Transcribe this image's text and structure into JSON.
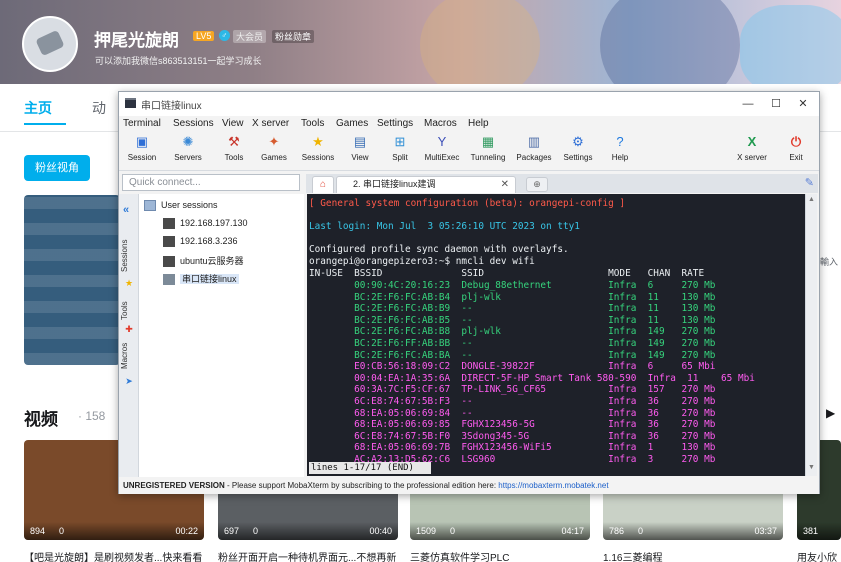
{
  "profile": {
    "username": "押尾光旋朗",
    "level": "LV5",
    "gender_symbol": "♂",
    "vip_badge": "大会员",
    "medal_badge": "粉丝勋章",
    "signature": "可以添加我微信s863513151一起学习成长",
    "nav_home": "主页",
    "nav_dynamic": "动",
    "fans_view_button": "粉丝视角",
    "right_cut_text": "輸入",
    "videos_title": "视频",
    "videos_count": "· 158",
    "next_arrow": "▶"
  },
  "videos": [
    {
      "views": "894",
      "danmaku": "0",
      "duration": "00:22",
      "title": "【吧是光旋朗】是刷视频发者...快来看看",
      "color": "#7a4a2a"
    },
    {
      "views": "697",
      "danmaku": "0",
      "duration": "00:40",
      "title": "粉丝开面开启一种待机界面元...不想再新",
      "color": "#5b5f63"
    },
    {
      "views": "1509",
      "danmaku": "0",
      "duration": "04:17",
      "title": "三菱仿真软件学习PLC",
      "color": "#b8c4b4"
    },
    {
      "views": "786",
      "danmaku": "0",
      "duration": "03:37",
      "title": "1.16三菱编程",
      "color": "#c9d1c6"
    },
    {
      "views": "381",
      "danmaku": "",
      "duration": "",
      "title": "用友小欣",
      "color": "#2d3a2c"
    }
  ],
  "window": {
    "title": "串口链接linux",
    "minimize": "—",
    "maximize": "☐",
    "close": "✕"
  },
  "menu": [
    "Terminal",
    "Sessions",
    "View",
    "X server",
    "Tools",
    "Games",
    "Settings",
    "Macros",
    "Help"
  ],
  "toolbar": [
    {
      "label": "Session",
      "icon": "session-icon",
      "glyph": "▣",
      "color": "#2f6fd6"
    },
    {
      "label": "Servers",
      "icon": "servers-icon",
      "glyph": "✺",
      "color": "#3a89d6"
    },
    {
      "label": "Tools",
      "icon": "tools-icon",
      "glyph": "⚒",
      "color": "#c8342a"
    },
    {
      "label": "Games",
      "icon": "games-icon",
      "glyph": "✦",
      "color": "#d65b2f"
    },
    {
      "label": "Sessions",
      "icon": "star-icon",
      "glyph": "★",
      "color": "#f0b400"
    },
    {
      "label": "View",
      "icon": "view-icon",
      "glyph": "▤",
      "color": "#3a6fb5"
    },
    {
      "label": "Split",
      "icon": "split-icon",
      "glyph": "⊞",
      "color": "#2f8fd6"
    },
    {
      "label": "MultiExec",
      "icon": "multiexec-icon",
      "glyph": "Y",
      "color": "#3c4fb8"
    },
    {
      "label": "Tunneling",
      "icon": "tunneling-icon",
      "glyph": "▦",
      "color": "#2f9a5f"
    },
    {
      "label": "Packages",
      "icon": "packages-icon",
      "glyph": "▥",
      "color": "#4f6ea8"
    },
    {
      "label": "Settings",
      "icon": "settings-icon",
      "glyph": "⚙",
      "color": "#2f6fd6"
    },
    {
      "label": "Help",
      "icon": "help-icon",
      "glyph": "?",
      "color": "#1e7ae0"
    }
  ],
  "toolbar_right": [
    {
      "label": "X server",
      "icon": "xserver-icon",
      "glyph": "X",
      "color": "#1f9a4f"
    },
    {
      "label": "Exit",
      "icon": "exit-icon",
      "glyph": "⏻",
      "color": "#e13a2b"
    }
  ],
  "quick_connect_placeholder": "Quick connect...",
  "tabs": {
    "home_glyph": "⌂",
    "active_tab": "2. 串口链接linux建调",
    "close_glyph": "✕",
    "new_tab_glyph": "⊕"
  },
  "rail": {
    "chevron": "«",
    "sessions_label": "Sessions",
    "tools_label": "Tools",
    "macros_label": "Macros"
  },
  "sessions": {
    "root": "User sessions",
    "items": [
      "192.168.197.130",
      "192.168.3.236",
      "ubuntu云服务器",
      "串口链接linux"
    ]
  },
  "terminal": {
    "header": "[ General system configuration (beta): orangepi-config ]",
    "last_login": "Last login: Mon Jul  3 05:26:10 UTC 2023 on tty1",
    "profile_sync": "Configured profile sync daemon with overlayfs.",
    "prompt": "orangepi@orangepizero3:~$ nmcli dev wifi",
    "columns": "IN-USE  BSSID              SSID                      MODE   CHAN  RATE",
    "rows": [
      {
        "text": "        00:90:4C:20:16:23  Debug_88ethernet          Infra  6     270 Mb",
        "color": "green"
      },
      {
        "text": "        BC:2E:F6:FC:AB:B4  plj-wlk                   Infra  11    130 Mb",
        "color": "green"
      },
      {
        "text": "        BC:2E:F6:FC:AB:B9  --                        Infra  11    130 Mb",
        "color": "green"
      },
      {
        "text": "        BC:2E:F6:FC:AB:B5  --                        Infra  11    130 Mb",
        "color": "green"
      },
      {
        "text": "        BC:2E:F6:FC:AB:B8  plj-wlk                   Infra  149   270 Mb",
        "color": "green"
      },
      {
        "text": "        BC:2E:F6:FF:AB:BB  --                        Infra  149   270 Mb",
        "color": "green"
      },
      {
        "text": "        BC:2E:F6:FC:AB:BA  --                        Infra  149   270 Mb",
        "color": "green"
      },
      {
        "text": "        E0:CB:56:18:09:C2  DONGLE-39822F             Infra  6     65 Mbi",
        "color": "magenta"
      },
      {
        "text": "        00:04:EA:1A:35:6A  DIRECT-5F-HP Smart Tank 580-590  Infra  11    65 Mbi",
        "color": "magenta"
      },
      {
        "text": "        60:3A:7C:F5:CF:67  TP-LINK_5G_CF65           Infra  157   270 Mb",
        "color": "magenta"
      },
      {
        "text": "        6C:E8:74:67:5B:F3  --                        Infra  36    270 Mb",
        "color": "magenta"
      },
      {
        "text": "        68:EA:05:06:69:84  --                        Infra  36    270 Mb",
        "color": "magenta"
      },
      {
        "text": "        68:EA:05:06:69:85  FGHX123456-5G             Infra  36    270 Mb",
        "color": "magenta"
      },
      {
        "text": "        6C:E8:74:67:5B:F0  3Sdong345-5G              Infra  36    270 Mb",
        "color": "magenta"
      },
      {
        "text": "        68:EA:05:06:69:7B  FGHX123456-WiFi5          Infra  1     130 Mb",
        "color": "magenta"
      },
      {
        "text": "        AC:A2:13:D5:62:C6  LSG960                    Infra  3     270 Mb",
        "color": "magenta"
      }
    ],
    "status": "lines 1-17/17 (END)"
  },
  "statusbar": {
    "unregistered": "UNREGISTERED VERSION",
    "message": " -  Please support MobaXterm by subscribing to the professional edition here: ",
    "link": "https://mobaxterm.mobatek.net"
  },
  "colors": {
    "accent": "#00aeec",
    "terminal_bg": "#1e2129",
    "ssid_header": "#ff5a4a",
    "green_rows": "#36d47d",
    "magenta_rows": "#ff5cf0"
  }
}
